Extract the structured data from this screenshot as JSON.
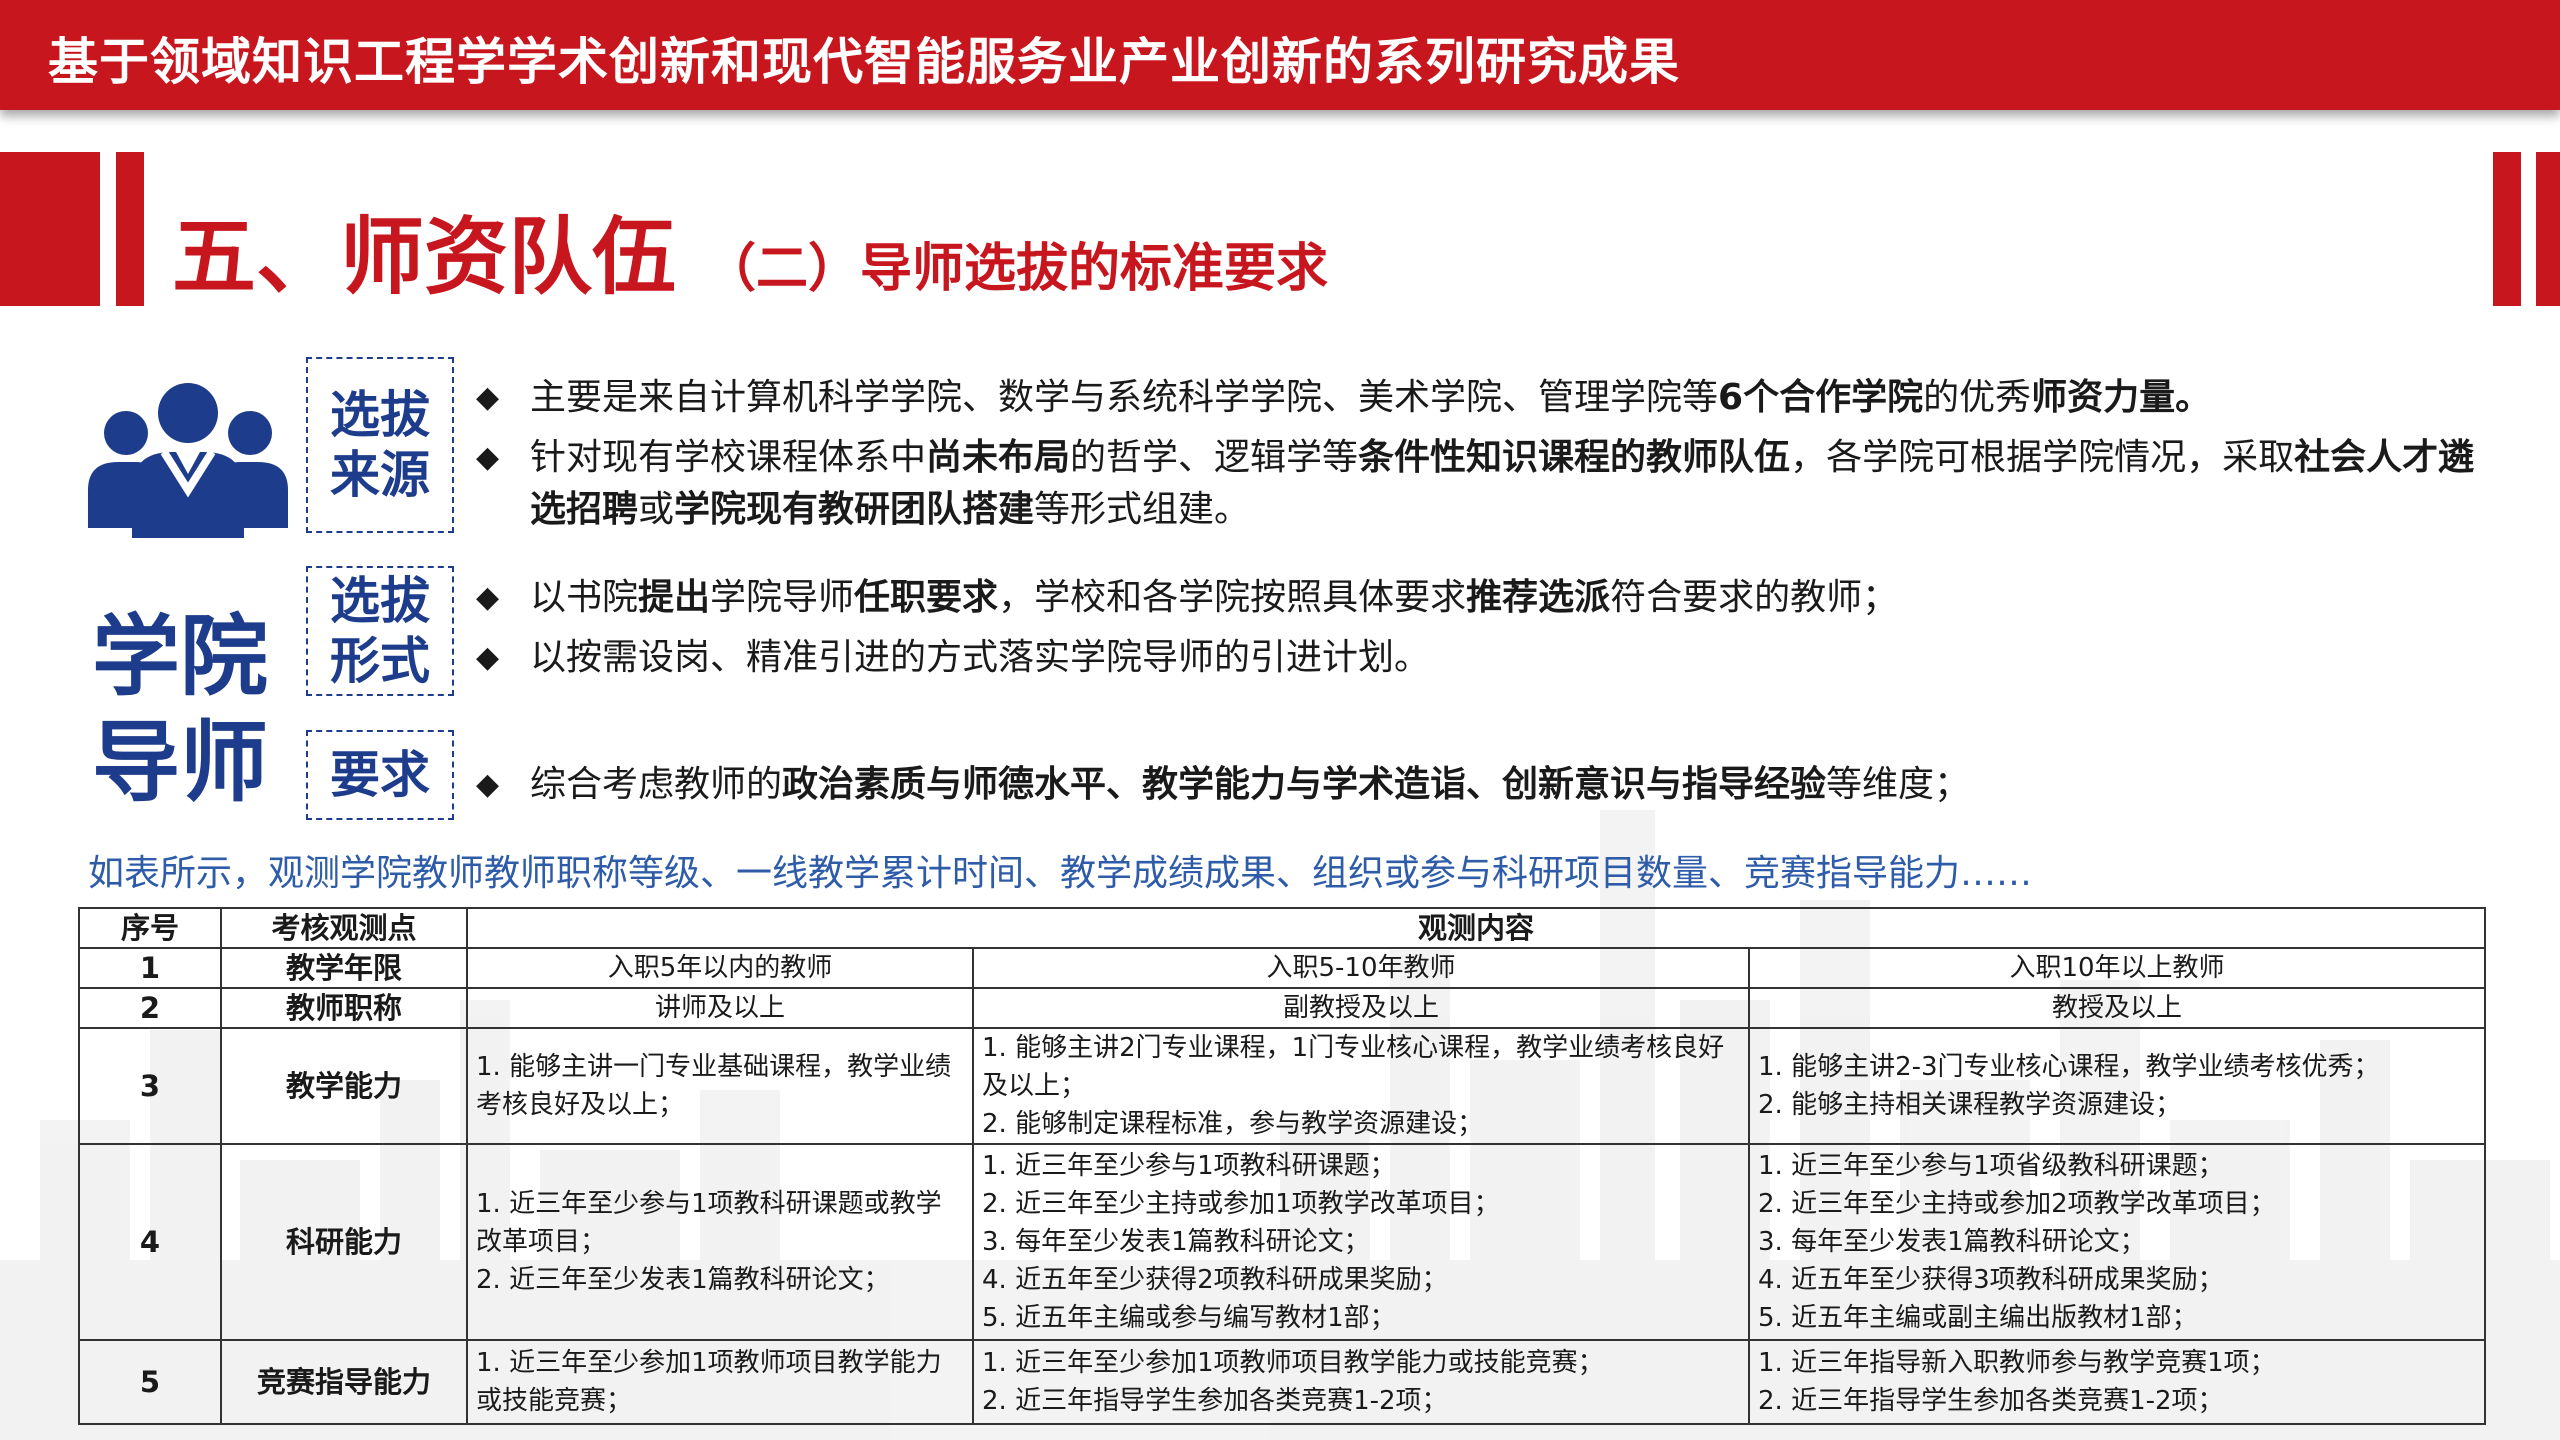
{
  "top_title": "基于领域知识工程学学术创新和现代智能服务业产业创新的系列研究成果",
  "heading": {
    "main": "五、师资队伍",
    "sub": "（二）导师选拔的标准要求"
  },
  "side_title": "学院导师",
  "icon": "people-group-icon",
  "colors": {
    "brand_red": "#c8161e",
    "navy": "#1e3c8c",
    "note_blue": "#2e5ca8"
  },
  "sections": [
    {
      "label": "选拔来源",
      "bullets": [
        [
          {
            "t": "主要是来自计算机科学学院、数学与系统科学学院、美术学院、管理学院等",
            "b": false
          },
          {
            "t": "6个合作学院",
            "b": true
          },
          {
            "t": "的优秀",
            "b": false
          },
          {
            "t": "师资力量。",
            "b": true
          }
        ],
        [
          {
            "t": "针对现有学校课程体系中",
            "b": false
          },
          {
            "t": "尚未布局",
            "b": true
          },
          {
            "t": "的哲学、逻辑学等",
            "b": false
          },
          {
            "t": "条件性知识课程的教师队伍",
            "b": true
          },
          {
            "t": "，各学院可根据学院情况，采取",
            "b": false
          },
          {
            "t": "社会人才遴选招聘",
            "b": true
          },
          {
            "t": "或",
            "b": false
          },
          {
            "t": "学院现有教研团队搭建",
            "b": true
          },
          {
            "t": "等形式组建。",
            "b": false
          }
        ]
      ]
    },
    {
      "label": "选拔形式",
      "bullets": [
        [
          {
            "t": "以书院",
            "b": false
          },
          {
            "t": "提出",
            "b": true
          },
          {
            "t": "学院导师",
            "b": false
          },
          {
            "t": "任职要求",
            "b": true
          },
          {
            "t": "，学校和各学院按照具体要求",
            "b": false
          },
          {
            "t": "推荐选派",
            "b": true
          },
          {
            "t": "符合要求的教师；",
            "b": false
          }
        ],
        [
          {
            "t": "以按需设岗、精准引进的方式落实学院导师的引进计划。",
            "b": false
          }
        ]
      ]
    },
    {
      "label": "要求",
      "bullets": [
        [
          {
            "t": "综合考虑教师的",
            "b": false
          },
          {
            "t": "政治素质与师德水平、教学能力与学术造诣、创新意识与指导经验",
            "b": true
          },
          {
            "t": "等维度；",
            "b": false
          }
        ]
      ]
    }
  ],
  "note": "如表所示，观测学院教师教师职称等级、一线教学累计时间、教学成绩成果、组织或参与科研项目数量、竞赛指导能力……",
  "table": {
    "headers": {
      "no": "序号",
      "point": "考核观测点",
      "content": "观测内容"
    },
    "rows": [
      {
        "no": "1",
        "point": "教学年限",
        "cols": [
          [
            "入职5年以内的教师"
          ],
          [
            "入职5-10年教师"
          ],
          [
            "入职10年以上教师"
          ]
        ]
      },
      {
        "no": "2",
        "point": "教师职称",
        "cols": [
          [
            "讲师及以上"
          ],
          [
            "副教授及以上"
          ],
          [
            "教授及以上"
          ]
        ]
      },
      {
        "no": "3",
        "point": "教学能力",
        "cols": [
          [
            "1. 能够主讲一门专业基础课程，教学业绩考核良好及以上；"
          ],
          [
            "1. 能够主讲2门专业课程，1门专业核心课程，教学业绩考核良好及以上；",
            "2. 能够制定课程标准，参与教学资源建设；"
          ],
          [
            "1. 能够主讲2-3门专业核心课程，教学业绩考核优秀；",
            "2. 能够主持相关课程教学资源建设；"
          ]
        ]
      },
      {
        "no": "4",
        "point": "科研能力",
        "cols": [
          [
            "1. 近三年至少参与1项教科研课题或教学改革项目；",
            "2. 近三年至少发表1篇教科研论文；"
          ],
          [
            "1. 近三年至少参与1项教科研课题；",
            "2. 近三年至少主持或参加1项教学改革项目；",
            "3. 每年至少发表1篇教科研论文；",
            "4. 近五年至少获得2项教科研成果奖励；",
            "5. 近五年主编或参与编写教材1部；"
          ],
          [
            "1. 近三年至少参与1项省级教科研课题；",
            "2. 近三年至少主持或参加2项教学改革项目；",
            "3. 每年至少发表1篇教科研论文；",
            "4. 近五年至少获得3项教科研成果奖励；",
            "5. 近五年主编或副主编出版教材1部；"
          ]
        ]
      },
      {
        "no": "5",
        "point": "竞赛指导能力",
        "cols": [
          [
            "1. 近三年至少参加1项教师项目教学能力或技能竞赛；"
          ],
          [
            "1. 近三年至少参加1项教师项目教学能力或技能竞赛；",
            "2. 近三年指导学生参加各类竞赛1-2项；"
          ],
          [
            "1. 近三年指导新入职教师参与教学竞赛1项；",
            "2. 近三年指导学生参加各类竞赛1-2项；"
          ]
        ]
      }
    ]
  }
}
